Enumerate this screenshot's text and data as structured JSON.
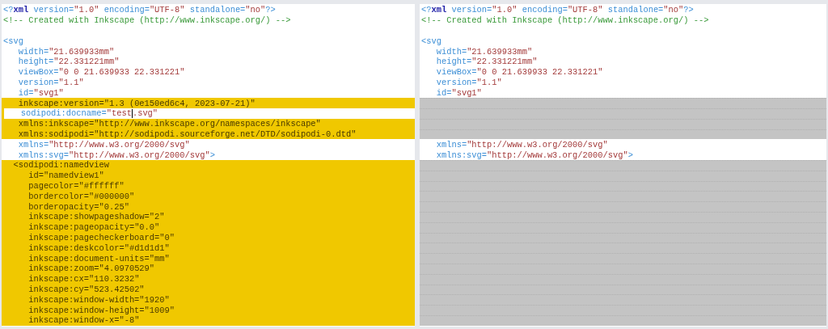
{
  "panes": [
    {
      "lines": [
        {
          "kind": "code",
          "changed": false,
          "tokens": [
            {
              "kind": "punct",
              "text": "<?"
            },
            {
              "kind": "decl",
              "text": "xml"
            },
            {
              "kind": "attr",
              "text": " version="
            },
            {
              "kind": "value",
              "text": "\"1.0\""
            },
            {
              "kind": "attr",
              "text": " encoding="
            },
            {
              "kind": "value",
              "text": "\"UTF-8\""
            },
            {
              "kind": "attr",
              "text": " standalone="
            },
            {
              "kind": "value",
              "text": "\"no\""
            },
            {
              "kind": "punct",
              "text": "?>"
            }
          ]
        },
        {
          "kind": "code",
          "changed": false,
          "tokens": [
            {
              "kind": "comment",
              "text": "<!-- Created with Inkscape (http://www.inkscape.org/) -->"
            }
          ]
        },
        {
          "kind": "blank"
        },
        {
          "kind": "code",
          "changed": false,
          "tokens": [
            {
              "kind": "punct",
              "text": "<svg"
            }
          ]
        },
        {
          "kind": "code",
          "changed": false,
          "tokens": [
            {
              "kind": "attr",
              "text": "   width="
            },
            {
              "kind": "value",
              "text": "\"21.639933mm\""
            }
          ]
        },
        {
          "kind": "code",
          "changed": false,
          "tokens": [
            {
              "kind": "attr",
              "text": "   height="
            },
            {
              "kind": "value",
              "text": "\"22.331221mm\""
            }
          ]
        },
        {
          "kind": "code",
          "changed": false,
          "tokens": [
            {
              "kind": "attr",
              "text": "   viewBox="
            },
            {
              "kind": "value",
              "text": "\"0 0 21.639933 22.331221\""
            }
          ]
        },
        {
          "kind": "code",
          "changed": false,
          "tokens": [
            {
              "kind": "attr",
              "text": "   version="
            },
            {
              "kind": "value",
              "text": "\"1.1\""
            }
          ]
        },
        {
          "kind": "code",
          "changed": false,
          "tokens": [
            {
              "kind": "attr",
              "text": "   id="
            },
            {
              "kind": "value",
              "text": "\"svg1\""
            }
          ]
        },
        {
          "kind": "code",
          "changed": true,
          "tokens": [
            {
              "kind": "attr",
              "text": "   inkscape:version="
            },
            {
              "kind": "value",
              "text": "\"1.3 (0e150ed6c4, 2023-07-21)\""
            }
          ]
        },
        {
          "kind": "code",
          "changed": true,
          "current": true,
          "tokens": [
            {
              "kind": "attr",
              "text": "   sodipodi:docname="
            },
            {
              "kind": "value",
              "text": "\"test"
            },
            {
              "kind": "caret"
            },
            {
              "kind": "value",
              "text": ".svg\""
            }
          ]
        },
        {
          "kind": "code",
          "changed": true,
          "tokens": [
            {
              "kind": "attr",
              "text": "   xmlns:inkscape="
            },
            {
              "kind": "value",
              "text": "\"http://www.inkscape.org/namespaces/inkscape\""
            }
          ]
        },
        {
          "kind": "code",
          "changed": true,
          "tokens": [
            {
              "kind": "attr",
              "text": "   xmlns:sodipodi="
            },
            {
              "kind": "value",
              "text": "\"http://sodipodi.sourceforge.net/DTD/sodipodi-0.dtd\""
            }
          ]
        },
        {
          "kind": "code",
          "changed": false,
          "tokens": [
            {
              "kind": "attr",
              "text": "   xmlns="
            },
            {
              "kind": "value",
              "text": "\"http://www.w3.org/2000/svg\""
            }
          ]
        },
        {
          "kind": "code",
          "changed": false,
          "tokens": [
            {
              "kind": "attr",
              "text": "   xmlns:svg="
            },
            {
              "kind": "value",
              "text": "\"http://www.w3.org/2000/svg\""
            },
            {
              "kind": "punct",
              "text": ">"
            }
          ]
        },
        {
          "kind": "code",
          "changed": true,
          "tokens": [
            {
              "kind": "punct",
              "text": "  <sodipodi:namedview"
            }
          ]
        },
        {
          "kind": "code",
          "changed": true,
          "tokens": [
            {
              "kind": "attr",
              "text": "     id="
            },
            {
              "kind": "value",
              "text": "\"namedview1\""
            }
          ]
        },
        {
          "kind": "code",
          "changed": true,
          "tokens": [
            {
              "kind": "attr",
              "text": "     pagecolor="
            },
            {
              "kind": "value",
              "text": "\"#ffffff\""
            }
          ]
        },
        {
          "kind": "code",
          "changed": true,
          "tokens": [
            {
              "kind": "attr",
              "text": "     bordercolor="
            },
            {
              "kind": "value",
              "text": "\"#000000\""
            }
          ]
        },
        {
          "kind": "code",
          "changed": true,
          "tokens": [
            {
              "kind": "attr",
              "text": "     borderopacity="
            },
            {
              "kind": "value",
              "text": "\"0.25\""
            }
          ]
        },
        {
          "kind": "code",
          "changed": true,
          "tokens": [
            {
              "kind": "attr",
              "text": "     inkscape:showpageshadow="
            },
            {
              "kind": "value",
              "text": "\"2\""
            }
          ]
        },
        {
          "kind": "code",
          "changed": true,
          "tokens": [
            {
              "kind": "attr",
              "text": "     inkscape:pageopacity="
            },
            {
              "kind": "value",
              "text": "\"0.0\""
            }
          ]
        },
        {
          "kind": "code",
          "changed": true,
          "tokens": [
            {
              "kind": "attr",
              "text": "     inkscape:pagecheckerboard="
            },
            {
              "kind": "value",
              "text": "\"0\""
            }
          ]
        },
        {
          "kind": "code",
          "changed": true,
          "tokens": [
            {
              "kind": "attr",
              "text": "     inkscape:deskcolor="
            },
            {
              "kind": "value",
              "text": "\"#d1d1d1\""
            }
          ]
        },
        {
          "kind": "code",
          "changed": true,
          "tokens": [
            {
              "kind": "attr",
              "text": "     inkscape:document-units="
            },
            {
              "kind": "value",
              "text": "\"mm\""
            }
          ]
        },
        {
          "kind": "code",
          "changed": true,
          "tokens": [
            {
              "kind": "attr",
              "text": "     inkscape:zoom="
            },
            {
              "kind": "value",
              "text": "\"4.0970529\""
            }
          ]
        },
        {
          "kind": "code",
          "changed": true,
          "tokens": [
            {
              "kind": "attr",
              "text": "     inkscape:cx="
            },
            {
              "kind": "value",
              "text": "\"110.3232\""
            }
          ]
        },
        {
          "kind": "code",
          "changed": true,
          "tokens": [
            {
              "kind": "attr",
              "text": "     inkscape:cy="
            },
            {
              "kind": "value",
              "text": "\"523.42502\""
            }
          ]
        },
        {
          "kind": "code",
          "changed": true,
          "tokens": [
            {
              "kind": "attr",
              "text": "     inkscape:window-width="
            },
            {
              "kind": "value",
              "text": "\"1920\""
            }
          ]
        },
        {
          "kind": "code",
          "changed": true,
          "tokens": [
            {
              "kind": "attr",
              "text": "     inkscape:window-height="
            },
            {
              "kind": "value",
              "text": "\"1009\""
            }
          ]
        },
        {
          "kind": "code",
          "changed": true,
          "tokens": [
            {
              "kind": "attr",
              "text": "     inkscape:window-x="
            },
            {
              "kind": "value",
              "text": "\"-8\""
            }
          ]
        }
      ]
    },
    {
      "lines": [
        {
          "kind": "code",
          "changed": false,
          "tokens": [
            {
              "kind": "punct",
              "text": "<?"
            },
            {
              "kind": "decl",
              "text": "xml"
            },
            {
              "kind": "attr",
              "text": " version="
            },
            {
              "kind": "value",
              "text": "\"1.0\""
            },
            {
              "kind": "attr",
              "text": " encoding="
            },
            {
              "kind": "value",
              "text": "\"UTF-8\""
            },
            {
              "kind": "attr",
              "text": " standalone="
            },
            {
              "kind": "value",
              "text": "\"no\""
            },
            {
              "kind": "punct",
              "text": "?>"
            }
          ]
        },
        {
          "kind": "code",
          "changed": false,
          "tokens": [
            {
              "kind": "comment",
              "text": "<!-- Created with Inkscape (http://www.inkscape.org/) -->"
            }
          ]
        },
        {
          "kind": "blank"
        },
        {
          "kind": "code",
          "changed": false,
          "tokens": [
            {
              "kind": "punct",
              "text": "<svg"
            }
          ]
        },
        {
          "kind": "code",
          "changed": false,
          "tokens": [
            {
              "kind": "attr",
              "text": "   width="
            },
            {
              "kind": "value",
              "text": "\"21.639933mm\""
            }
          ]
        },
        {
          "kind": "code",
          "changed": false,
          "tokens": [
            {
              "kind": "attr",
              "text": "   height="
            },
            {
              "kind": "value",
              "text": "\"22.331221mm\""
            }
          ]
        },
        {
          "kind": "code",
          "changed": false,
          "tokens": [
            {
              "kind": "attr",
              "text": "   viewBox="
            },
            {
              "kind": "value",
              "text": "\"0 0 21.639933 22.331221\""
            }
          ]
        },
        {
          "kind": "code",
          "changed": false,
          "tokens": [
            {
              "kind": "attr",
              "text": "   version="
            },
            {
              "kind": "value",
              "text": "\"1.1\""
            }
          ]
        },
        {
          "kind": "code",
          "changed": false,
          "tokens": [
            {
              "kind": "attr",
              "text": "   id="
            },
            {
              "kind": "value",
              "text": "\"svg1\""
            }
          ]
        },
        {
          "kind": "gap"
        },
        {
          "kind": "gap"
        },
        {
          "kind": "gap"
        },
        {
          "kind": "gap"
        },
        {
          "kind": "code",
          "changed": false,
          "tokens": [
            {
              "kind": "attr",
              "text": "   xmlns="
            },
            {
              "kind": "value",
              "text": "\"http://www.w3.org/2000/svg\""
            }
          ]
        },
        {
          "kind": "code",
          "changed": false,
          "tokens": [
            {
              "kind": "attr",
              "text": "   xmlns:svg="
            },
            {
              "kind": "value",
              "text": "\"http://www.w3.org/2000/svg\""
            },
            {
              "kind": "punct",
              "text": ">"
            }
          ]
        },
        {
          "kind": "gap"
        },
        {
          "kind": "gap"
        },
        {
          "kind": "gap"
        },
        {
          "kind": "gap"
        },
        {
          "kind": "gap"
        },
        {
          "kind": "gap"
        },
        {
          "kind": "gap"
        },
        {
          "kind": "gap"
        },
        {
          "kind": "gap"
        },
        {
          "kind": "gap"
        },
        {
          "kind": "gap"
        },
        {
          "kind": "gap"
        },
        {
          "kind": "gap"
        },
        {
          "kind": "gap"
        },
        {
          "kind": "gap"
        },
        {
          "kind": "gap"
        }
      ]
    }
  ]
}
